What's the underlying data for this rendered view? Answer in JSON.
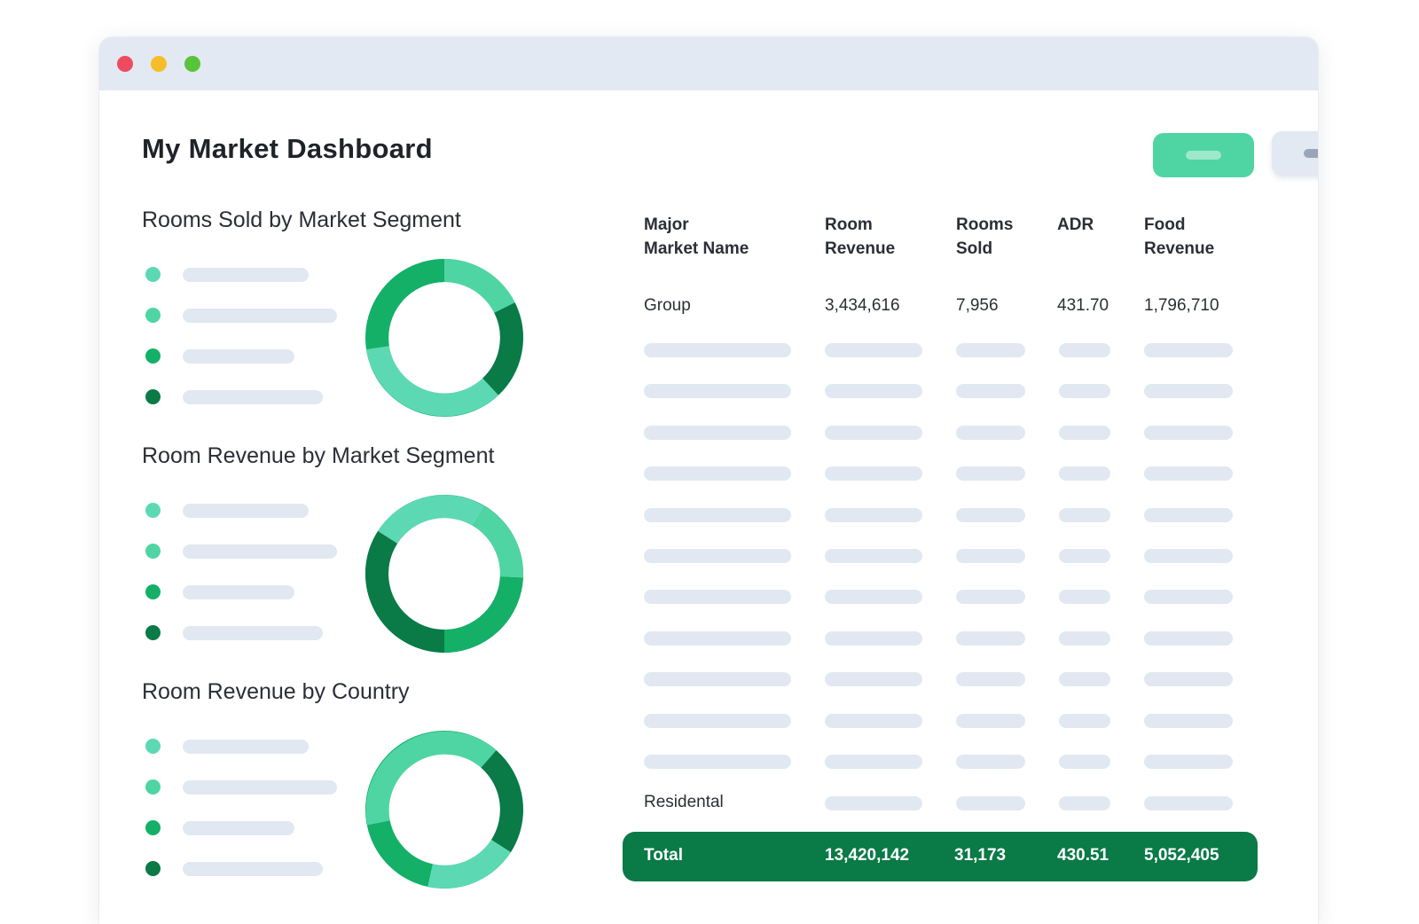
{
  "window": {
    "controls": [
      "close",
      "minimize",
      "maximize"
    ]
  },
  "page": {
    "title": "My Market Dashboard"
  },
  "colors": {
    "teal": "#4fd5a4",
    "green": "#14b068",
    "dark_green": "#0a7a47",
    "mint": "#5cd9b2",
    "placeholder": "#e2e8f1"
  },
  "sections": [
    {
      "title": "Rooms Sold by Market Segment"
    },
    {
      "title": "Room Revenue by Market Segment"
    },
    {
      "title": "Room Revenue by Country"
    }
  ],
  "table": {
    "headers": [
      "Major\nMarket Name",
      "Room\nRevenue",
      "Rooms\nSold",
      "ADR",
      "Food\nRevenue"
    ],
    "first_row": {
      "name": "Group",
      "room_revenue": "3,434,616",
      "rooms_sold": "7,956",
      "adr": "431.70",
      "food_revenue": "1,796,710"
    },
    "last_row": {
      "name": "Residental"
    },
    "total": {
      "label": "Total",
      "room_revenue": "13,420,142",
      "rooms_sold": "31,173",
      "adr": "430.51",
      "food_revenue": "5,052,405"
    }
  }
}
